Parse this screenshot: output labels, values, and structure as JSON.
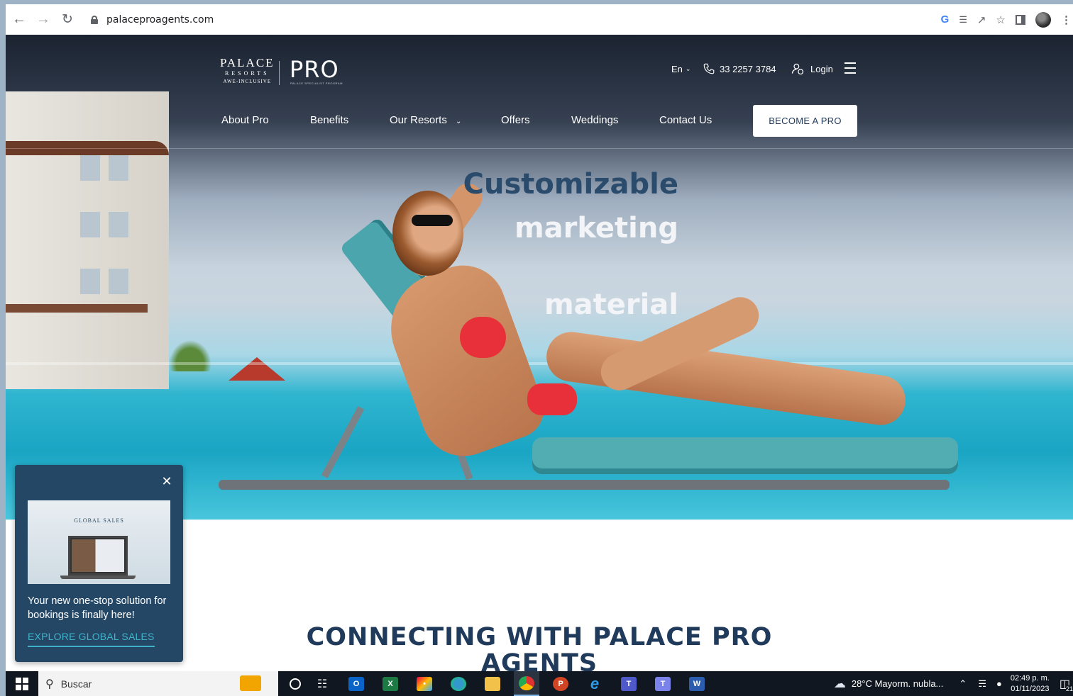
{
  "browser": {
    "url": "palaceproagents.com",
    "icons": [
      "back-arrow-icon",
      "forward-arrow-icon",
      "reload-icon",
      "lock-icon",
      "google-icon",
      "translate-icon",
      "share-icon",
      "star-icon",
      "side-panel-icon",
      "profile-avatar",
      "menu-dots-icon"
    ]
  },
  "site": {
    "logo_palace": "PALACE",
    "logo_resorts": "RESORTS",
    "logo_tagline": "AWE-INCLUSIVE",
    "logo_pro": "PRO",
    "logo_pro_tagline": "PALACE SPECIALIST PROGRAM",
    "lang": "En",
    "phone": "33 2257 3784",
    "login": "Login",
    "nav": [
      "About Pro",
      "Benefits",
      "Our Resorts",
      "Offers",
      "Weddings",
      "Contact Us"
    ],
    "cta": "BECOME A PRO",
    "headline": [
      "Customizable",
      "marketing",
      "material"
    ],
    "section_title_1": "CONNECTING WITH PALACE PRO",
    "section_title_2": "AGENTS"
  },
  "popup": {
    "brand": "GLOBAL SALES",
    "text": "Your new one-stop solution for bookings is finally here!",
    "link": "EXPLORE GLOBAL SALES"
  },
  "taskbar": {
    "search": "Buscar",
    "weather": "28°C  Mayorm. nubla...",
    "time": "02:49 p. m.",
    "date": "01/11/2023",
    "notif_count": "21",
    "apps": [
      "Outlook",
      "Excel",
      "Paint",
      "Edge",
      "File Explorer",
      "Chrome",
      "PowerPoint",
      "Internet Explorer",
      "Teams (work)",
      "Teams",
      "Word"
    ],
    "colors": {
      "bg": "#101721",
      "accent": "#7fb6e6"
    }
  },
  "colors": {
    "navy": "#244766",
    "teal": "#3fb2c9",
    "headline_dark": "#2a4b6b"
  }
}
